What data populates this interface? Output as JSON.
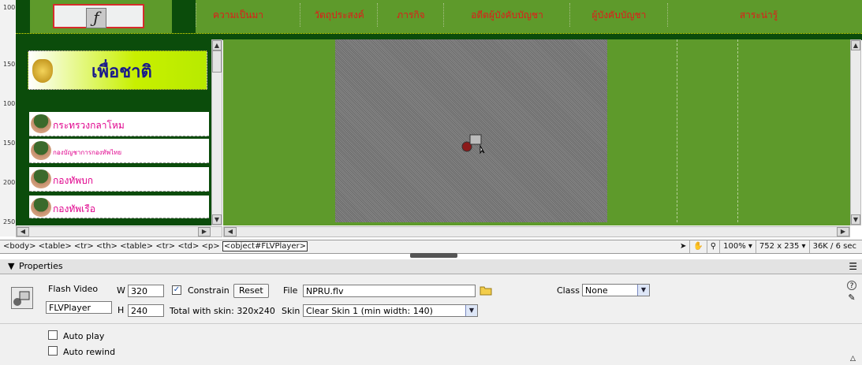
{
  "nav": {
    "items": [
      "ความเป็นมา",
      "วัตถุประสงค์",
      "ภารกิจ",
      "อดีตผู้บังคับบัญชา",
      "ผู้บังคับบัญชา",
      "สาระน่ารู้"
    ]
  },
  "ruler_labels": [
    "100",
    "150",
    "100",
    "150",
    "200",
    "250"
  ],
  "sidebar": {
    "logo_text": "เพื่อชาติ",
    "links": [
      {
        "label": "กระทรวงกลาโหม"
      },
      {
        "label": "กองบัญชาการกองทัพไทย"
      },
      {
        "label": "กองทัพบก"
      },
      {
        "label": "กองทัพเรือ"
      }
    ]
  },
  "tag_selector": {
    "path": "<body> <table> <tr> <th> <table> <tr> <td> <p>",
    "active_tag": "<object#FLVPlayer>",
    "zoom": "100%",
    "window_size": "752 x 235",
    "download": "36K / 6 sec"
  },
  "properties": {
    "header": "Properties",
    "type_label": "Flash Video",
    "name_value": "FLVPlayer",
    "w_label": "W",
    "w_value": "320",
    "h_label": "H",
    "h_value": "240",
    "constrain_label": "Constrain",
    "constrain_checked": true,
    "reset_label": "Reset",
    "total_skin": "Total with skin: 320x240",
    "file_label": "File",
    "file_value": "NPRU.flv",
    "skin_label": "Skin",
    "skin_value": "Clear Skin 1 (min width: 140)",
    "class_label": "Class",
    "class_value": "None",
    "autoplay_label": "Auto play",
    "autorewind_label": "Auto rewind"
  },
  "colors": {
    "banner_green": "#5e9a2b",
    "dark_green": "#0b4c0b",
    "nav_text": "#e11a1a",
    "link_text": "#e0008c"
  }
}
